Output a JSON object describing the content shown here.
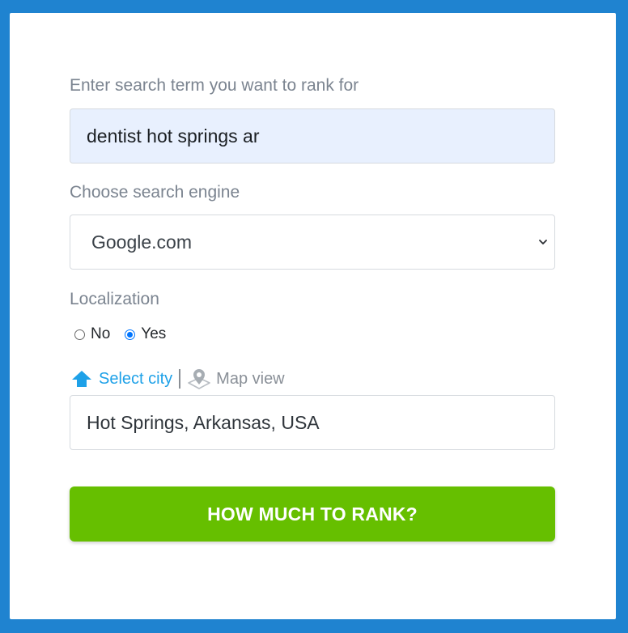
{
  "form": {
    "search_label": "Enter search term you want to rank for",
    "search_value": "dentist hot springs ar",
    "engine_label": "Choose search engine",
    "engine_selected": "Google.com",
    "localization_label": "Localization",
    "radio_no": "No",
    "radio_yes": "Yes",
    "localization_selected": "Yes",
    "select_city_label": "Select city",
    "map_view_label": "Map view",
    "location_value": "Hot Springs, Arkansas, USA",
    "submit_label": "HOW MUCH TO RANK?"
  },
  "icons": {
    "select_city": "home-arrow-icon",
    "map_view": "map-pin-icon",
    "select_chevron": "chevron-down-icon"
  },
  "colors": {
    "page_background": "#1f83d0",
    "card_background": "#ffffff",
    "button_green": "#66bf00",
    "link_blue": "#1ea1e8",
    "radio_blue": "#0075ff",
    "autofill_background": "#e8f0fe"
  }
}
